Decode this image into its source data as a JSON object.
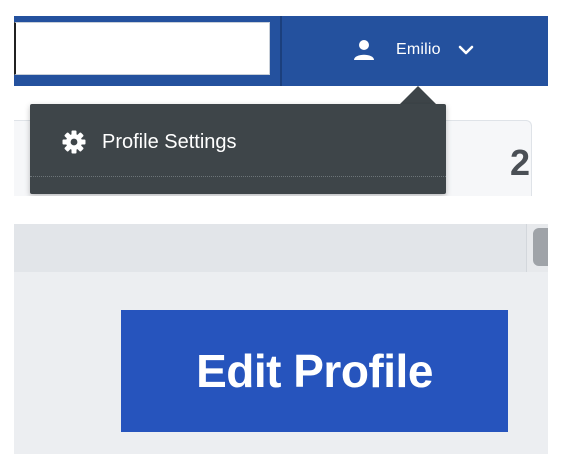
{
  "header": {
    "search": {
      "value": "",
      "placeholder": ""
    },
    "user_menu": {
      "user_name": "Emilio",
      "user_icon": "person-icon",
      "chevron_icon": "chevron-down-icon"
    }
  },
  "dropdown": {
    "items": [
      {
        "label": "Profile Settings",
        "icon": "gear-icon"
      }
    ]
  },
  "background_card": {
    "stat_fragment": "2"
  },
  "main": {
    "edit_profile_label": "Edit Profile"
  },
  "colors": {
    "header_blue": "#24519e",
    "dropdown_bg": "#3e4549",
    "button_blue": "#2654bd",
    "panel_grey": "#e2e5e9",
    "main_bg": "#eceef1"
  }
}
